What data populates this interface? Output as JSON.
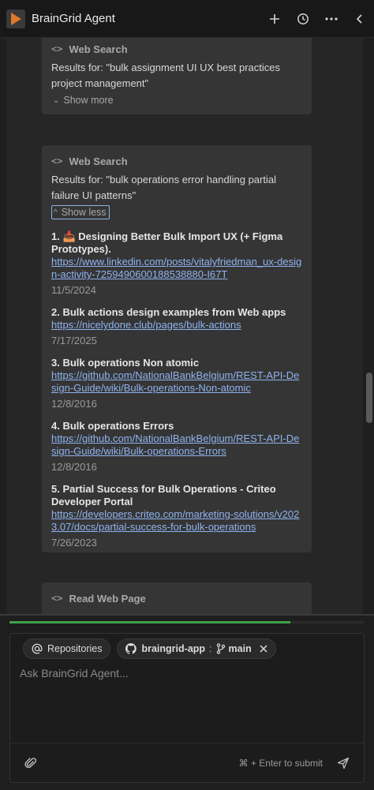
{
  "header": {
    "title": "BrainGrid Agent",
    "icons": [
      "play-logo-icon",
      "plus-icon",
      "history-clock-icon",
      "more-icon",
      "chevron-left-icon"
    ]
  },
  "cards": [
    {
      "heading": "Web Search",
      "query": "Results for: \"bulk assignment UI UX best practices project management\"",
      "toggle": "Show more"
    },
    {
      "heading": "Web Search",
      "query": "Results for: \"bulk operations error handling partial failure UI patterns\"",
      "toggle": "Show less",
      "results": [
        {
          "title": "1. 📥 Designing Better Bulk Import UX (+ Figma Prototypes).",
          "link": "https://www.linkedin.com/posts/vitalyfriedman_ux-design-activity-7259490600188538880-I67T",
          "date": "11/5/2024"
        },
        {
          "title": "2. Bulk actions design examples from Web apps",
          "link": "https://nicelydone.club/pages/bulk-actions",
          "date": "7/17/2025"
        },
        {
          "title": "3. Bulk operations Non atomic",
          "link": "https://github.com/NationalBankBelgium/REST-API-Design-Guide/wiki/Bulk-operations-Non-atomic",
          "date": "12/8/2016"
        },
        {
          "title": "4. Bulk operations Errors",
          "link": "https://github.com/NationalBankBelgium/REST-API-Design-Guide/wiki/Bulk-operations-Errors",
          "date": "12/8/2016"
        },
        {
          "title": "5. Partial Success for Bulk Operations - Criteo Developer Portal",
          "link": "https://developers.criteo.com/marketing-solutions/v2023.07/docs/partial-success-for-bulk-operations",
          "date": "7/26/2023"
        }
      ]
    },
    {
      "heading": "Read Web Page"
    }
  ],
  "progress_fraction": 0.79,
  "composer": {
    "chip_repos": "Repositories",
    "chip_repo_name": "braingrid-app",
    "chip_branch": "main",
    "placeholder": "Ask BrainGrid Agent...",
    "hint": "⌘ + Enter to submit"
  },
  "colors": {
    "accent": "#3aa24c",
    "link": "#8fb3f0",
    "logo": "#e0782b"
  }
}
